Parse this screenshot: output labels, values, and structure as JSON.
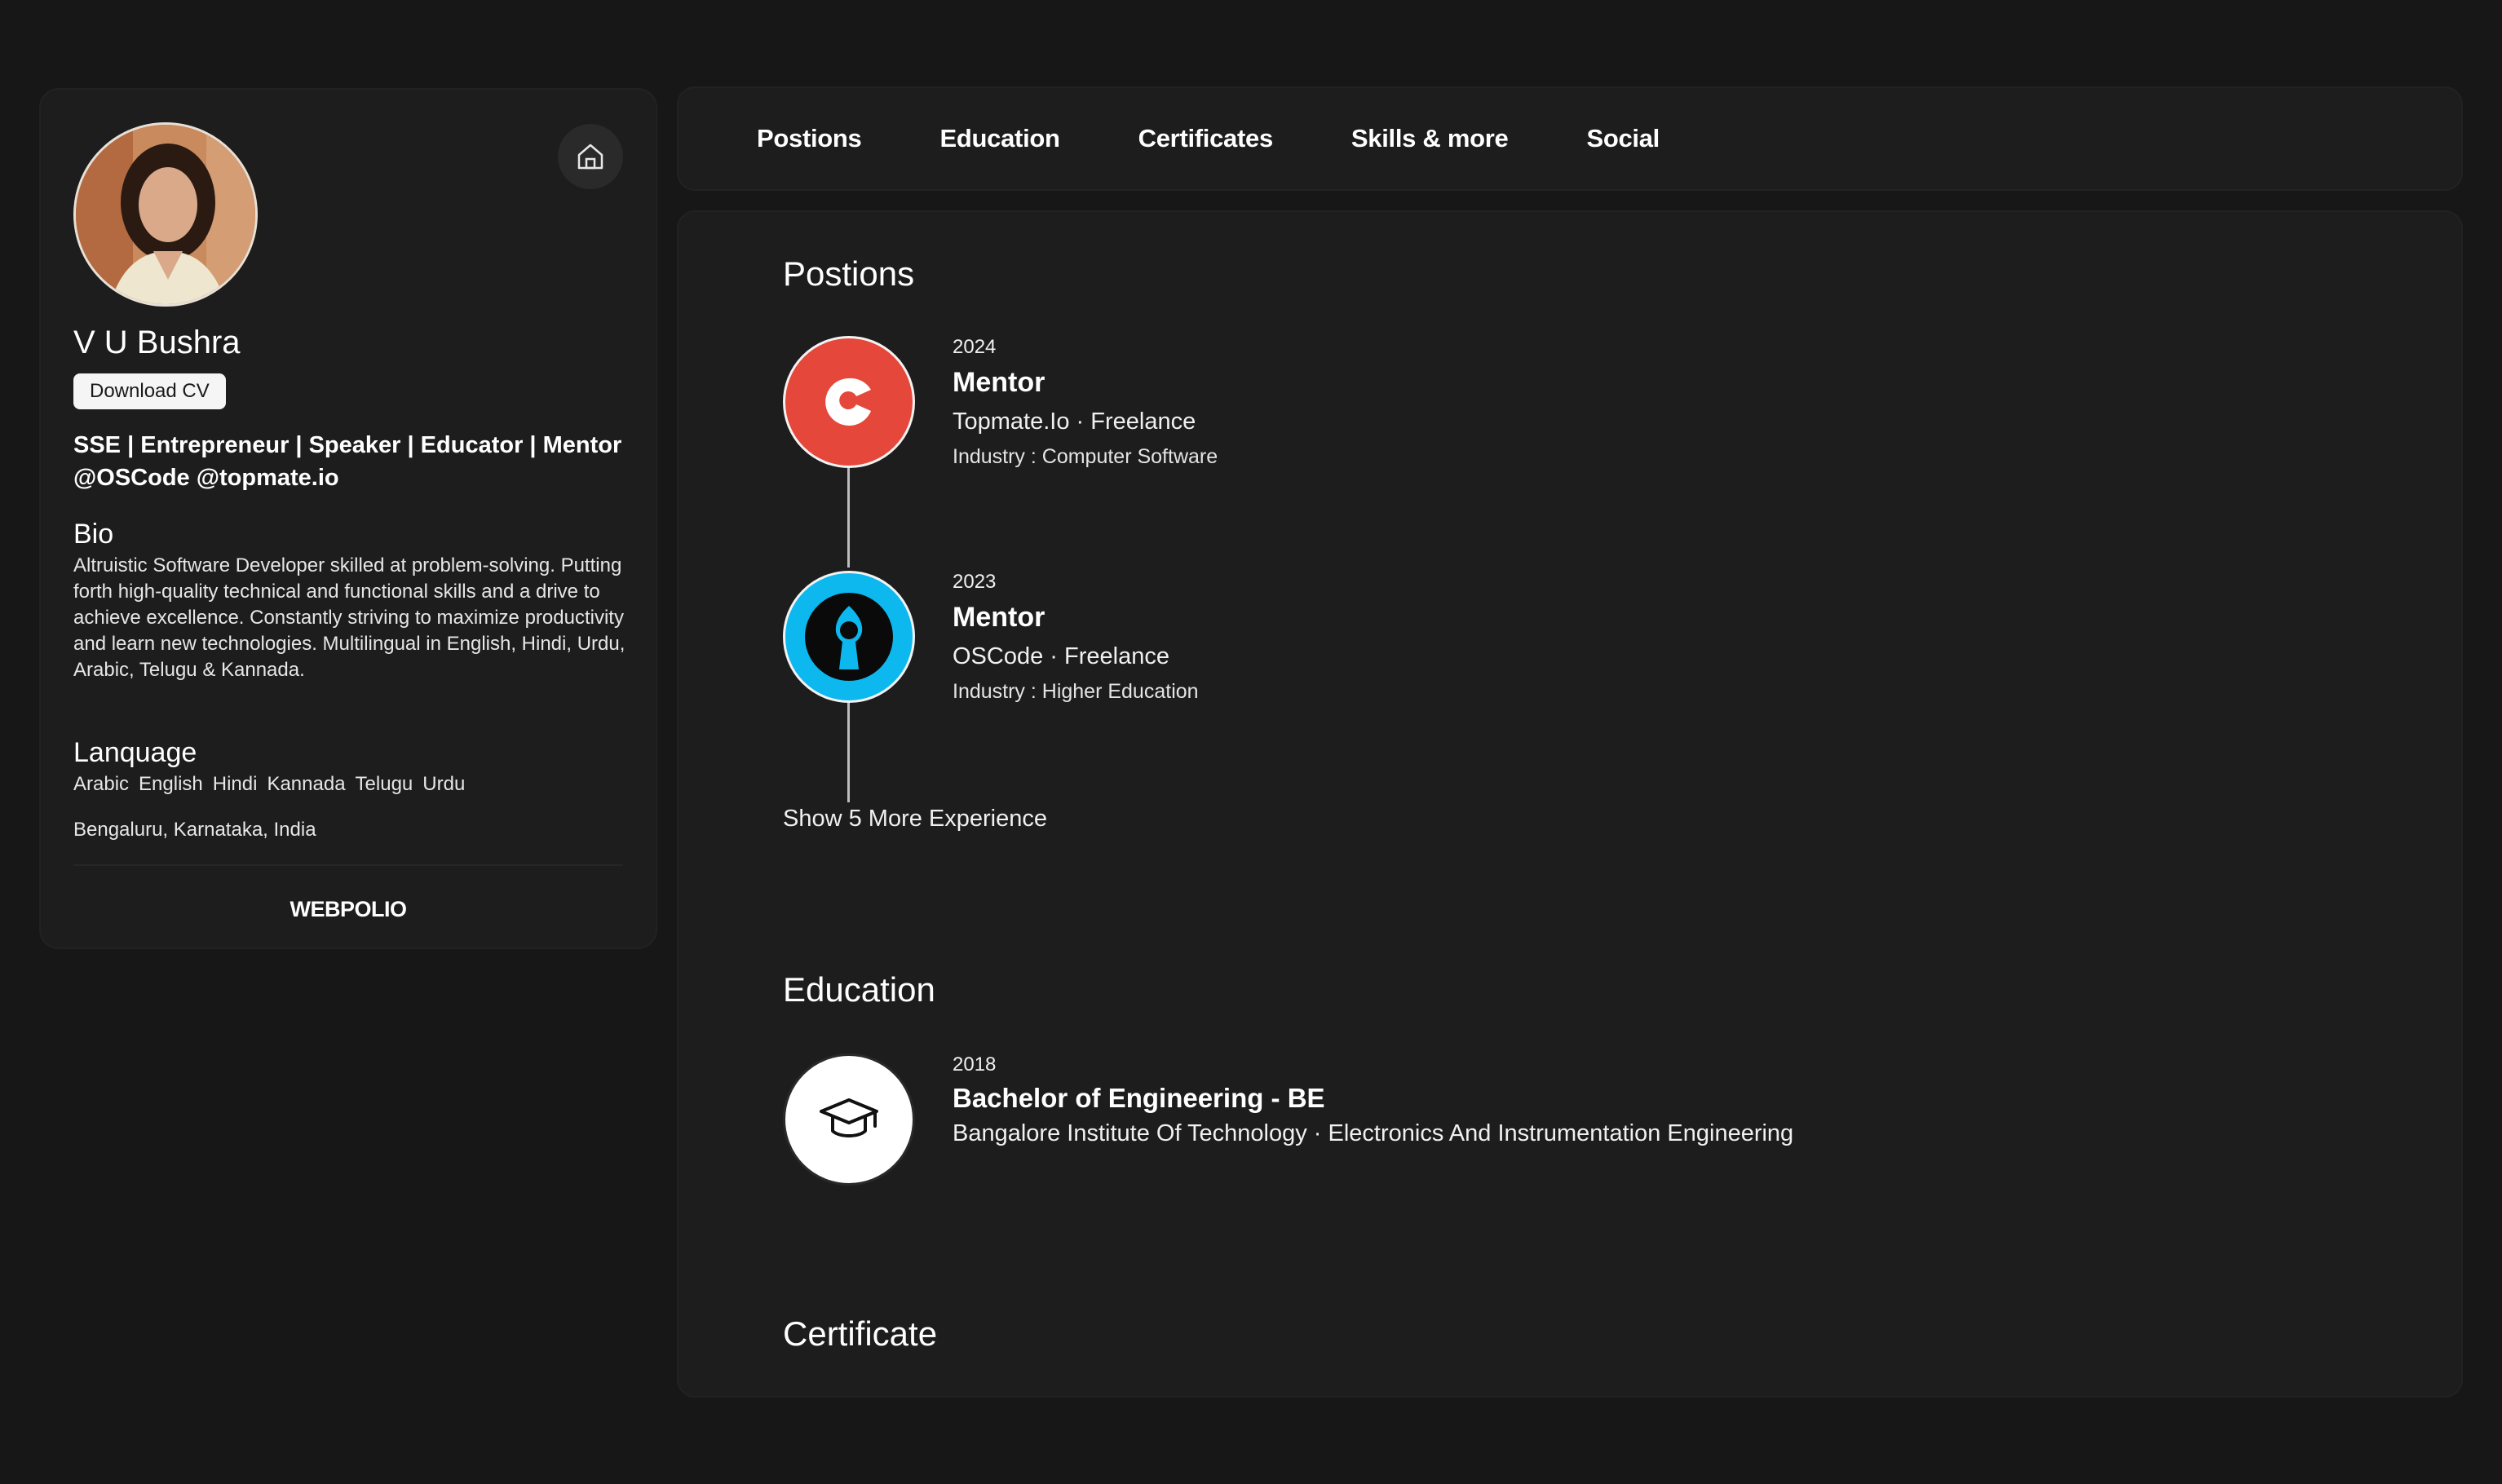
{
  "profile": {
    "name": "V U Bushra",
    "download_cv_label": "Download CV",
    "headline": "SSE | Entrepreneur | Speaker | Educator | Mentor @OSCode @topmate.io",
    "bio_title": "Bio",
    "bio": "Altruistic Software Developer skilled at problem-solving. Putting forth high-quality technical and functional skills and a drive to achieve excellence. Constantly striving to maximize productivity and learn new technologies. Multilingual in English, Hindi, Urdu, Arabic, Telugu & Kannada.",
    "language_title": "Lanquage",
    "languages": [
      "Arabic",
      "English",
      "Hindi",
      "Kannada",
      "Telugu",
      "Urdu"
    ],
    "location": "Bengaluru, Karnataka, India",
    "footer_brand": "WEBPOLIO",
    "home_icon": "home-icon"
  },
  "tabs": [
    "Postions",
    "Education",
    "Certificates",
    "Skills & more",
    "Social"
  ],
  "positions": {
    "heading": "Postions",
    "items": [
      {
        "year": "2024",
        "title": "Mentor",
        "company": "Topmate.Io · Freelance",
        "industry": "Industry : Computer Software",
        "logo_color": "#e5473b",
        "logo_icon": "topmate-logo-icon"
      },
      {
        "year": "2023",
        "title": "Mentor",
        "company": "OSCode · Freelance",
        "industry": "Industry : Higher Education",
        "logo_color": "#0cb8ee",
        "logo_icon": "oscode-logo-icon"
      }
    ],
    "show_more_label": "Show 5 More Experience"
  },
  "education": {
    "heading": "Education",
    "items": [
      {
        "year": "2018",
        "degree": "Bachelor of Engineering - BE",
        "school": "Bangalore Institute Of Technology · Electronics And Instrumentation Engineering",
        "logo_icon": "graduation-cap-icon"
      }
    ]
  },
  "certificate": {
    "heading": "Certificate"
  },
  "colors": {
    "background": "#171717",
    "card": "#1d1d1d",
    "text": "#ffffff",
    "topmate_red": "#e5473b",
    "oscode_blue": "#0cb8ee"
  }
}
